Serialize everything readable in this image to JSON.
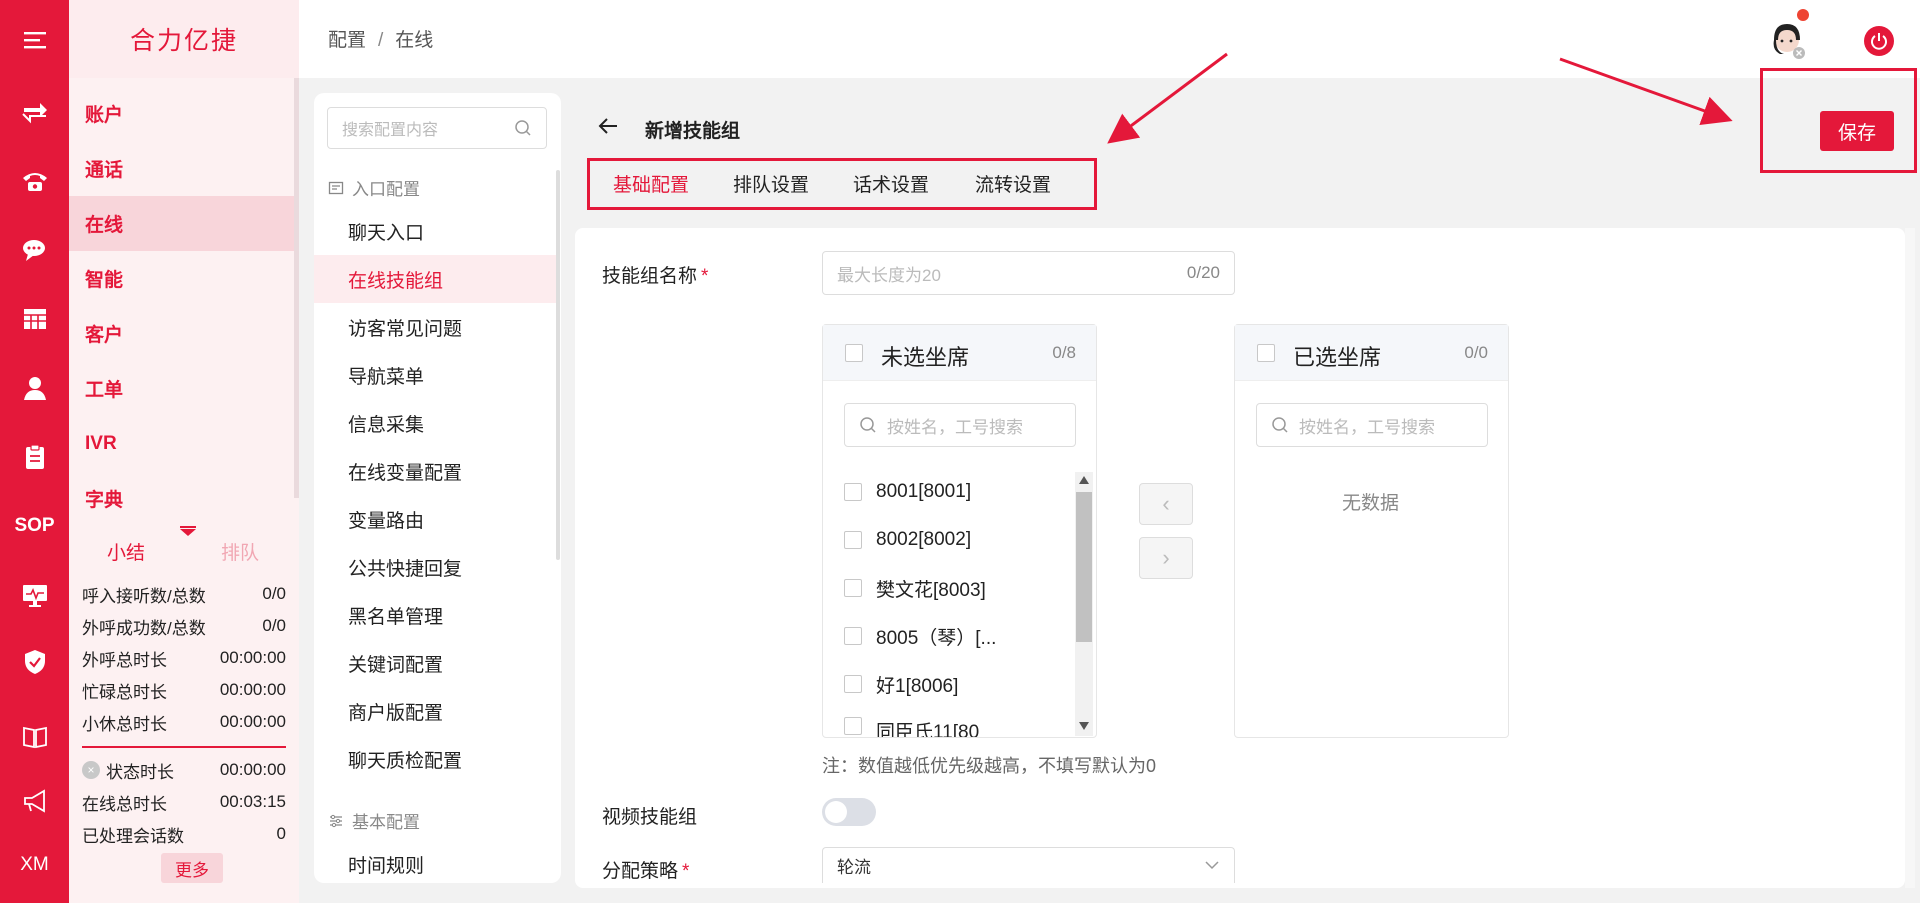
{
  "brand": "合力亿捷",
  "rail": {
    "sop_label": "SOP",
    "xm_label": "XM",
    "icons": [
      "menu-icon",
      "transfer-icon",
      "phone-icon",
      "chat-icon",
      "grid-icon",
      "user-icon",
      "clipboard-icon",
      "sop-icon",
      "monitor-icon",
      "shield-icon",
      "book-icon",
      "megaphone-icon",
      "xm-icon"
    ]
  },
  "menu": {
    "items": [
      "账户",
      "通话",
      "在线",
      "智能",
      "客户",
      "工单",
      "IVR",
      "字典"
    ],
    "active_index": 2
  },
  "stats": {
    "tab_summary": "小结",
    "tab_queue": "排队",
    "rows": [
      {
        "label": "呼入接听数/总数",
        "value": "0/0"
      },
      {
        "label": "外呼成功数/总数",
        "value": "0/0"
      },
      {
        "label": "外呼总时长",
        "value": "00:00:00"
      },
      {
        "label": "忙碌总时长",
        "value": "00:00:00"
      },
      {
        "label": "小休总时长",
        "value": "00:00:00"
      }
    ],
    "rows2": [
      {
        "label": "状态时长",
        "value": "00:00:00"
      },
      {
        "label": "在线总时长",
        "value": "00:03:15"
      },
      {
        "label": "已处理会话数",
        "value": "0"
      }
    ],
    "more_label": "更多"
  },
  "breadcrumb": {
    "first": "配置",
    "separator": "/",
    "second": "在线"
  },
  "config_panel": {
    "search_placeholder": "搜索配置内容",
    "group_entry": "入口配置",
    "items": [
      "聊天入口",
      "在线技能组",
      "访客常见问题",
      "导航菜单",
      "信息采集",
      "在线变量配置",
      "变量路由",
      "公共快捷回复",
      "黑名单管理",
      "关键词配置",
      "商户版配置",
      "聊天质检配置"
    ],
    "active_index": 1,
    "group_basic": "基本配置",
    "basic_items": [
      "时间规则"
    ]
  },
  "main": {
    "title": "新增技能组",
    "tabs": [
      "基础配置",
      "排队设置",
      "话术设置",
      "流转设置"
    ],
    "active_tab": 0,
    "save_label": "保存",
    "name_label": "技能组名称",
    "required_mark": "*",
    "name_placeholder": "最大长度为20",
    "name_count": "0/20",
    "transfer": {
      "left_title": "未选坐席",
      "left_count": "0/8",
      "right_title": "已选坐席",
      "right_count": "0/0",
      "search_placeholder": "按姓名，工号搜索",
      "left_items": [
        "8001[8001]",
        "8002[8002]",
        "樊文花[8003]",
        "8005（琴）[...",
        "好1[8006]",
        "同臣氏11[80"
      ],
      "empty_text": "无数据",
      "move_left": "‹",
      "move_right": "›"
    },
    "note": "注：数值越低优先级越高，不填写默认为0",
    "video_label": "视频技能组",
    "video_enabled": false,
    "strategy_label": "分配策略",
    "strategy_value": "轮流"
  },
  "colors": {
    "accent": "#e4183a",
    "menu_bg": "#fdf1f2"
  }
}
